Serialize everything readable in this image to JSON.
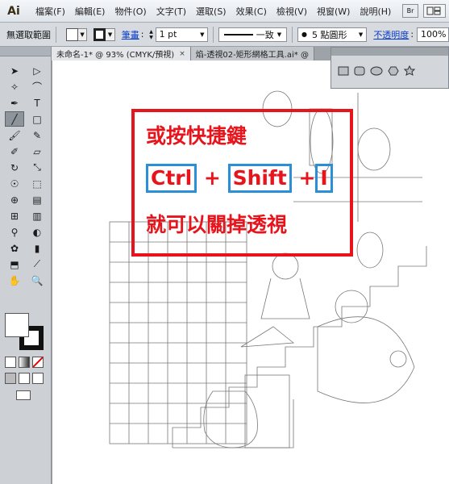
{
  "app": {
    "logo": "Ai",
    "bridge_badge": "Br"
  },
  "menu": [
    "檔案(F)",
    "編輯(E)",
    "物件(O)",
    "文字(T)",
    "選取(S)",
    "效果(C)",
    "檢視(V)",
    "視窗(W)",
    "說明(H)"
  ],
  "controlbar": {
    "selection_label": "無選取範圍",
    "stroke_link": "筆畫",
    "stroke_weight": "1 pt",
    "profile_label": "一致",
    "brush_label": "5 點圓形",
    "opacity_link": "不透明度",
    "opacity_value": "100%"
  },
  "tabs": [
    {
      "label": "未命名-1* @ 93% (CMYK/預視)",
      "close": "×"
    },
    {
      "label": "焰-透視02-矩形網格工具.ai* @",
      "close": ""
    }
  ],
  "annotation": {
    "line1": "或按快捷鍵",
    "key1": "Ctrl",
    "plus1": " + ",
    "key2": "Shift",
    "plus2": " +",
    "key3": "I",
    "line3": "就可以關掉透視"
  },
  "colors": {
    "accent_red": "#e8141c",
    "accent_blue": "#2a8fd8",
    "link_blue": "#0a3cc8"
  },
  "tool_icons": [
    "selection-icon",
    "direct-selection-icon",
    "magic-wand-icon",
    "lasso-icon",
    "pen-icon",
    "type-icon",
    "line-icon",
    "rectangle-icon",
    "paintbrush-icon",
    "pencil-icon",
    "blob-brush-icon",
    "eraser-icon",
    "rotate-icon",
    "scale-icon",
    "warp-icon",
    "free-transform-icon",
    "shape-builder-icon",
    "perspective-grid-icon",
    "mesh-icon",
    "gradient-icon",
    "eyedropper-icon",
    "blend-icon",
    "symbol-sprayer-icon",
    "column-graph-icon",
    "artboard-icon",
    "slice-icon",
    "hand-icon",
    "zoom-icon"
  ],
  "shape_icons": [
    "rectangle-shape-icon",
    "rounded-rectangle-shape-icon",
    "ellipse-shape-icon",
    "polygon-shape-icon",
    "star-shape-icon"
  ]
}
